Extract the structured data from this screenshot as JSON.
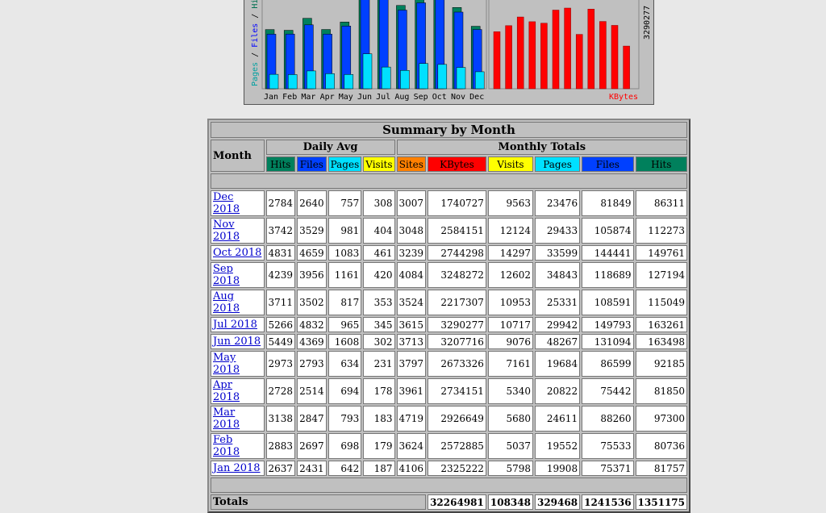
{
  "chart": {
    "months": [
      "Jan",
      "Feb",
      "Mar",
      "Apr",
      "May",
      "Jun",
      "Jul",
      "Aug",
      "Sep",
      "Oct",
      "Nov",
      "Dec"
    ],
    "y_label_pages": "Pages",
    "y_label_files": "Files",
    "y_label_hits": "Hits",
    "kbytes_label": "KBytes",
    "kbytes_max_label": "3290277",
    "colors": {
      "hits": "#00805c",
      "files": "#0040ff",
      "pages": "#00e0ff",
      "kbytes": "#ff0000",
      "visits": "#ffff00",
      "sites": "#ff8000"
    }
  },
  "summary": {
    "title": "Summary by Month",
    "month_header": "Month",
    "daily_avg_header": "Daily Avg",
    "monthly_totals_header": "Monthly Totals",
    "daily_cols": [
      "Hits",
      "Files",
      "Pages",
      "Visits"
    ],
    "monthly_cols": [
      "Sites",
      "KBytes",
      "Visits",
      "Pages",
      "Files",
      "Hits"
    ],
    "rows": [
      {
        "month": "Dec 2018",
        "d_hits": "2784",
        "d_files": "2640",
        "d_pages": "757",
        "d_visits": "308",
        "sites": "3007",
        "kbytes": "1740727",
        "visits": "9563",
        "pages": "23476",
        "files": "81849",
        "hits": "86311"
      },
      {
        "month": "Nov 2018",
        "d_hits": "3742",
        "d_files": "3529",
        "d_pages": "981",
        "d_visits": "404",
        "sites": "3048",
        "kbytes": "2584151",
        "visits": "12124",
        "pages": "29433",
        "files": "105874",
        "hits": "112273"
      },
      {
        "month": "Oct 2018",
        "d_hits": "4831",
        "d_files": "4659",
        "d_pages": "1083",
        "d_visits": "461",
        "sites": "3239",
        "kbytes": "2744298",
        "visits": "14297",
        "pages": "33599",
        "files": "144441",
        "hits": "149761"
      },
      {
        "month": "Sep 2018",
        "d_hits": "4239",
        "d_files": "3956",
        "d_pages": "1161",
        "d_visits": "420",
        "sites": "4084",
        "kbytes": "3248272",
        "visits": "12602",
        "pages": "34843",
        "files": "118689",
        "hits": "127194"
      },
      {
        "month": "Aug 2018",
        "d_hits": "3711",
        "d_files": "3502",
        "d_pages": "817",
        "d_visits": "353",
        "sites": "3524",
        "kbytes": "2217307",
        "visits": "10953",
        "pages": "25331",
        "files": "108591",
        "hits": "115049"
      },
      {
        "month": "Jul 2018",
        "d_hits": "5266",
        "d_files": "4832",
        "d_pages": "965",
        "d_visits": "345",
        "sites": "3615",
        "kbytes": "3290277",
        "visits": "10717",
        "pages": "29942",
        "files": "149793",
        "hits": "163261"
      },
      {
        "month": "Jun 2018",
        "d_hits": "5449",
        "d_files": "4369",
        "d_pages": "1608",
        "d_visits": "302",
        "sites": "3713",
        "kbytes": "3207716",
        "visits": "9076",
        "pages": "48267",
        "files": "131094",
        "hits": "163498"
      },
      {
        "month": "May 2018",
        "d_hits": "2973",
        "d_files": "2793",
        "d_pages": "634",
        "d_visits": "231",
        "sites": "3797",
        "kbytes": "2673326",
        "visits": "7161",
        "pages": "19684",
        "files": "86599",
        "hits": "92185"
      },
      {
        "month": "Apr 2018",
        "d_hits": "2728",
        "d_files": "2514",
        "d_pages": "694",
        "d_visits": "178",
        "sites": "3961",
        "kbytes": "2734151",
        "visits": "5340",
        "pages": "20822",
        "files": "75442",
        "hits": "81850"
      },
      {
        "month": "Mar 2018",
        "d_hits": "3138",
        "d_files": "2847",
        "d_pages": "793",
        "d_visits": "183",
        "sites": "4719",
        "kbytes": "2926649",
        "visits": "5680",
        "pages": "24611",
        "files": "88260",
        "hits": "97300"
      },
      {
        "month": "Feb 2018",
        "d_hits": "2883",
        "d_files": "2697",
        "d_pages": "698",
        "d_visits": "179",
        "sites": "3624",
        "kbytes": "2572885",
        "visits": "5037",
        "pages": "19552",
        "files": "75533",
        "hits": "80736"
      },
      {
        "month": "Jan 2018",
        "d_hits": "2637",
        "d_files": "2431",
        "d_pages": "642",
        "d_visits": "187",
        "sites": "4106",
        "kbytes": "2325222",
        "visits": "5798",
        "pages": "19908",
        "files": "75371",
        "hits": "81757"
      }
    ],
    "totals": {
      "label": "Totals",
      "kbytes": "32264981",
      "visits": "108348",
      "pages": "329468",
      "files": "1241536",
      "hits": "1351175"
    }
  }
}
